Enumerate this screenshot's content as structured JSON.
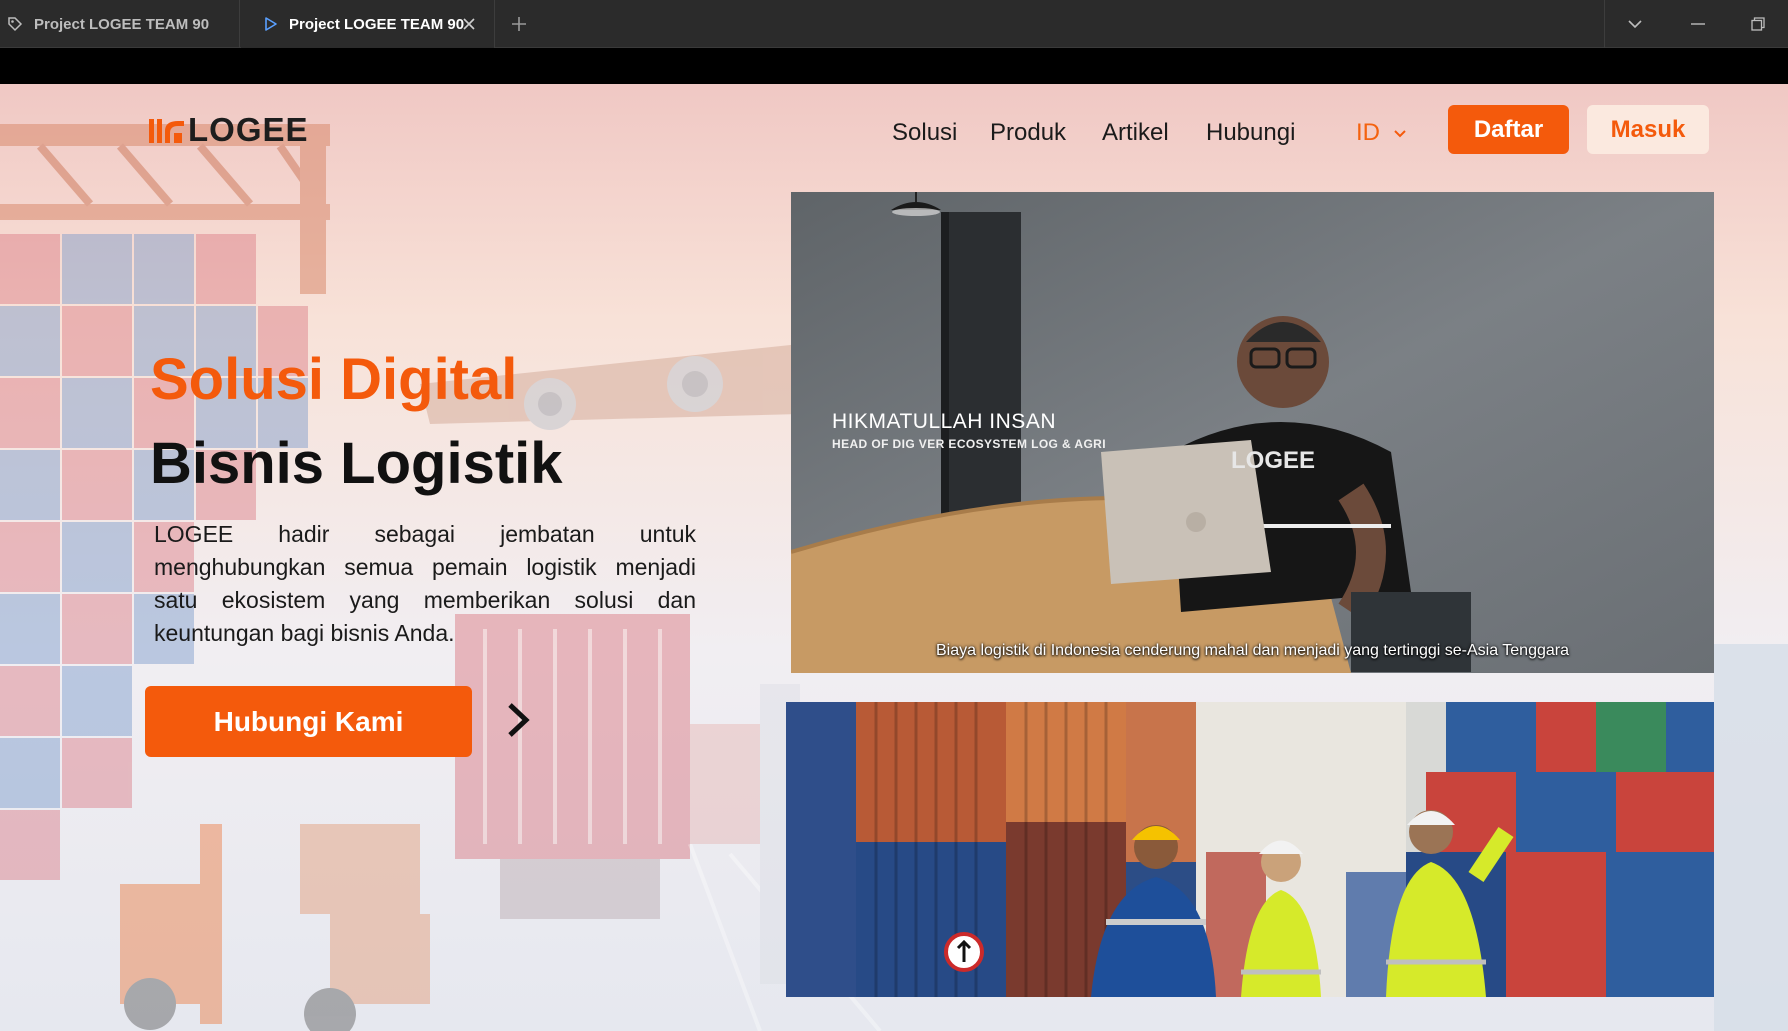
{
  "browser": {
    "tabs": [
      {
        "title": "Project LOGEE TEAM 90",
        "active": false
      },
      {
        "title": "Project LOGEE TEAM 90",
        "active": true
      }
    ]
  },
  "nav": {
    "logo_text": "LOGEE",
    "links": [
      "Solusi",
      "Produk",
      "Artikel",
      "Hubungi"
    ],
    "language": "ID",
    "register_label": "Daftar",
    "login_label": "Masuk"
  },
  "hero": {
    "title_line1": "Solusi Digital",
    "title_line2": "Bisnis Logistik",
    "description": "LOGEE hadir sebagai jembatan untuk menghubungkan semua pemain logistik menjadi satu ekosistem yang memberikan solusi dan keuntungan bagi bisnis Anda.",
    "cta_label": "Hubungi Kami"
  },
  "video": {
    "speaker_name": "HIKMATULLAH INSAN",
    "speaker_role": "HEAD OF DIG VER ECOSYSTEM LOG & AGRI",
    "shirt_logo": "LOGEE",
    "subtitle": "Biaya logistik di Indonesia cenderung mahal dan menjadi yang tertinggi se-Asia Tenggara"
  },
  "colors": {
    "brand_orange": "#f45a0c",
    "masuk_bg": "#fbe9df",
    "tabbar": "#2b2b2b"
  }
}
